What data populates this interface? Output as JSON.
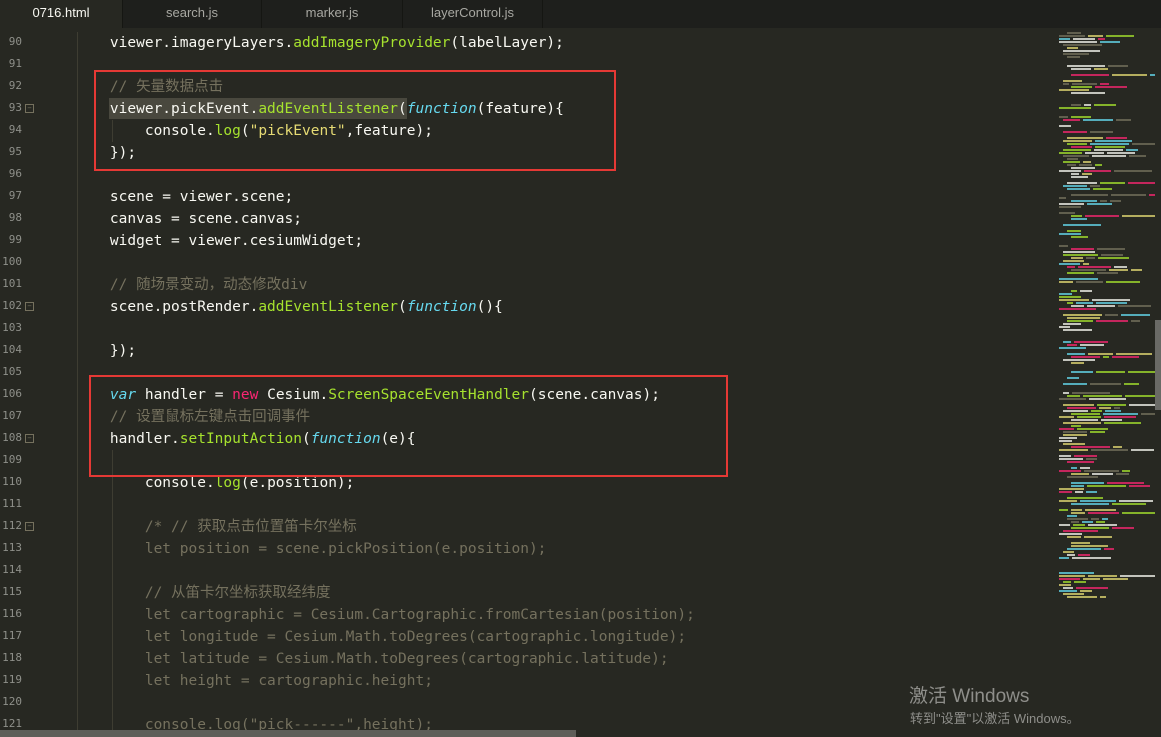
{
  "tabs": [
    {
      "label": "0716.html",
      "active": true
    },
    {
      "label": "search.js"
    },
    {
      "label": "marker.js"
    },
    {
      "label": "layerControl.js"
    }
  ],
  "line_numbers": [
    "90",
    "91",
    "92",
    "93",
    "94",
    "95",
    "96",
    "97",
    "98",
    "99",
    "100",
    "101",
    "102",
    "103",
    "104",
    "105",
    "106",
    "107",
    "108",
    "109",
    "110",
    "111",
    "112",
    "113",
    "114",
    "115",
    "116",
    "117",
    "118",
    "119",
    "120",
    "121"
  ],
  "fold_marks": [
    "93",
    "102",
    "108",
    "112"
  ],
  "code_lines": [
    [
      {
        "t": "    viewer.imageryLayers.",
        "c": "pl"
      },
      {
        "t": "addImageryProvider",
        "c": "mt"
      },
      {
        "t": "(labelLayer);",
        "c": "pl"
      }
    ],
    [],
    [
      {
        "t": "    // 矢量数据点击",
        "c": "cm"
      }
    ],
    [
      {
        "t": "    viewer.pickEvent.",
        "c": "pl"
      },
      {
        "t": "addEventListener",
        "c": "mt"
      },
      {
        "t": "(",
        "c": "pl"
      },
      {
        "t": "function",
        "c": "kw"
      },
      {
        "t": "(feature){",
        "c": "pl"
      }
    ],
    [
      {
        "t": "        console.",
        "c": "pl"
      },
      {
        "t": "log",
        "c": "mt"
      },
      {
        "t": "(",
        "c": "pl"
      },
      {
        "t": "\"pickEvent\"",
        "c": "st"
      },
      {
        "t": ",feature);",
        "c": "pl"
      }
    ],
    [
      {
        "t": "    });",
        "c": "pl"
      }
    ],
    [],
    [
      {
        "t": "    scene = viewer.scene;",
        "c": "pl"
      }
    ],
    [
      {
        "t": "    canvas = scene.canvas;",
        "c": "pl"
      }
    ],
    [
      {
        "t": "    widget = viewer.cesiumWidget;",
        "c": "pl"
      }
    ],
    [],
    [
      {
        "t": "    // 随场景变动，动态修改div",
        "c": "cm"
      }
    ],
    [
      {
        "t": "    scene.postRender.",
        "c": "pl"
      },
      {
        "t": "addEventListener",
        "c": "mt"
      },
      {
        "t": "(",
        "c": "pl"
      },
      {
        "t": "function",
        "c": "kw"
      },
      {
        "t": "(){",
        "c": "pl"
      }
    ],
    [],
    [
      {
        "t": "    });",
        "c": "pl"
      }
    ],
    [],
    [
      {
        "t": "    ",
        "c": "pl"
      },
      {
        "t": "var",
        "c": "kw"
      },
      {
        "t": " handler = ",
        "c": "pl"
      },
      {
        "t": "new",
        "c": "kr"
      },
      {
        "t": " Cesium.",
        "c": "pl"
      },
      {
        "t": "ScreenSpaceEventHandler",
        "c": "mt"
      },
      {
        "t": "(scene.canvas);",
        "c": "pl"
      }
    ],
    [
      {
        "t": "    // 设置鼠标左键点击回调事件",
        "c": "cm"
      }
    ],
    [
      {
        "t": "    handler.",
        "c": "pl"
      },
      {
        "t": "setInputAction",
        "c": "mt"
      },
      {
        "t": "(",
        "c": "pl"
      },
      {
        "t": "function",
        "c": "kw"
      },
      {
        "t": "(e){",
        "c": "pl"
      }
    ],
    [],
    [
      {
        "t": "        console.",
        "c": "pl"
      },
      {
        "t": "log",
        "c": "mt"
      },
      {
        "t": "(e.position);",
        "c": "pl"
      }
    ],
    [],
    [
      {
        "t": "        /* // 获取点击位置笛卡尔坐标",
        "c": "cm"
      }
    ],
    [
      {
        "t": "        let position = scene.pickPosition(e.position);",
        "c": "cm"
      }
    ],
    [],
    [
      {
        "t": "        // 从笛卡尔坐标获取经纬度",
        "c": "cm"
      }
    ],
    [
      {
        "t": "        let cartographic = Cesium.Cartographic.fromCartesian(position);",
        "c": "cm"
      }
    ],
    [
      {
        "t": "        let longitude = Cesium.Math.toDegrees(cartographic.longitude);",
        "c": "cm"
      }
    ],
    [
      {
        "t": "        let latitude = Cesium.Math.toDegrees(cartographic.latitude);",
        "c": "cm"
      }
    ],
    [
      {
        "t": "        let height = cartographic.height;",
        "c": "cm"
      }
    ],
    [],
    [
      {
        "t": "        console.log(\"pick------\",height);",
        "c": "cm"
      }
    ]
  ],
  "watermark": {
    "title": "激活 Windows",
    "subtitle": "转到\"设置\"以激活 Windows。"
  },
  "colors": {
    "background": "#272822",
    "comment": "#75715e",
    "method": "#a6e22e",
    "keyword": "#66d9ef",
    "keyword_red": "#f92672",
    "string": "#e6db74",
    "text": "#f8f8f2",
    "highlight_box": "#e53935"
  }
}
